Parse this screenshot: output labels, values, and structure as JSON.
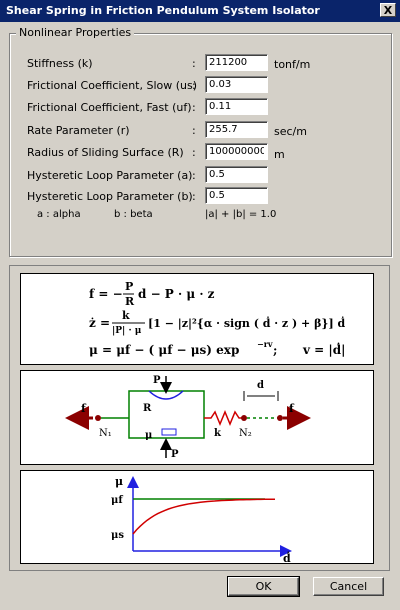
{
  "window": {
    "title": "Shear Spring in Friction Pendulum System Isolator",
    "close_label": "X"
  },
  "group": {
    "label": "Nonlinear Properties",
    "params": [
      {
        "label": "Stiffness (k)",
        "value": "211200",
        "unit": "tonf/m"
      },
      {
        "label": "Frictional Coefficient, Slow (us)",
        "value": "0.03",
        "unit": ""
      },
      {
        "label": "Frictional Coefficient, Fast (uf)",
        "value": "0.11",
        "unit": ""
      },
      {
        "label": "Rate Parameter (r)",
        "value": "255.7",
        "unit": "sec/m"
      },
      {
        "label": "Radius of Sliding Surface (R)",
        "value": "100000000",
        "unit": "m"
      },
      {
        "label": "Hysteretic Loop Parameter (a)",
        "value": "0.5",
        "unit": ""
      },
      {
        "label": "Hysteretic Loop Parameter (b)",
        "value": "0.5",
        "unit": ""
      }
    ],
    "colon": ":",
    "note_a": "a : alpha",
    "note_b": "b : beta",
    "note_c": "|a| + |b| = 1.0"
  },
  "formulas": {
    "f_lhs": "f = −",
    "f_frac_num": "P",
    "f_frac_den": "R",
    "f_rest": "d − P · μ · z",
    "z_lhs": "ż =",
    "z_frac_num": "k",
    "z_frac_den": "|P| · μ",
    "z_rest": "[1 − |z|²{α · sign ( ḋ · z ) + β}] ḋ",
    "mu_line": "μ  =  μf − ( μf − μs) exp",
    "mu_exp": "−rv",
    "mu_semicolon": ";",
    "v_def": "v = |ḋ|"
  },
  "diagram": {
    "f_left": "f",
    "f_right": "f",
    "P_top": "P",
    "P_bottom": "P",
    "R": "R",
    "mu": "μ",
    "k": "k",
    "N1": "N₁",
    "N2": "N₂",
    "d": "d"
  },
  "graph": {
    "y_axis": "μ",
    "uf": "μf",
    "us": "μs",
    "x_axis": "ḋ"
  },
  "buttons": {
    "ok": "OK",
    "cancel": "Cancel"
  },
  "colors": {
    "title_bg": "#0a246a",
    "arrow": "#8b0000",
    "spring": "#d00000",
    "block": "#008000",
    "blue": "#2020e0"
  }
}
